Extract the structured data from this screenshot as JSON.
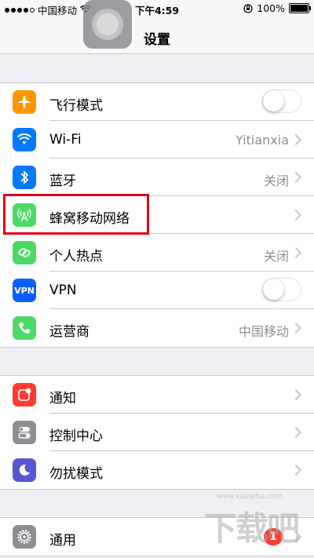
{
  "status_bar": {
    "carrier": "中国移动",
    "time": "下午4:59",
    "battery_percent": "100%",
    "signal_bars": 4
  },
  "nav": {
    "title": "设置"
  },
  "groups": [
    {
      "rows": [
        {
          "label": "飞行模式",
          "icon": "airplane-icon",
          "icon_color": "#ff9500",
          "control": "toggle",
          "on": false
        },
        {
          "label": "Wi-Fi",
          "icon": "wifi-icon",
          "icon_color": "#007aff",
          "value": "Yitianxia",
          "control": "chevron"
        },
        {
          "label": "蓝牙",
          "icon": "bluetooth-icon",
          "icon_color": "#007aff",
          "value": "关闭",
          "control": "chevron"
        },
        {
          "label": "蜂窝移动网络",
          "icon": "cellular-icon",
          "icon_color": "#4cd964",
          "control": "chevron"
        },
        {
          "label": "个人热点",
          "icon": "hotspot-icon",
          "icon_color": "#4cd964",
          "value": "关闭",
          "control": "chevron"
        },
        {
          "label": "VPN",
          "icon": "vpn-icon",
          "icon_text": "VPN",
          "icon_color": "#0a60ff",
          "control": "toggle",
          "on": false
        },
        {
          "label": "运营商",
          "icon": "phone-icon",
          "icon_color": "#4cd964",
          "value": "中国移动",
          "control": "chevron"
        }
      ]
    },
    {
      "rows": [
        {
          "label": "通知",
          "icon": "notifications-icon",
          "icon_color": "#ff3b30",
          "control": "chevron"
        },
        {
          "label": "控制中心",
          "icon": "control-center-icon",
          "icon_color": "#8e8e93",
          "control": "chevron"
        },
        {
          "label": "勿扰模式",
          "icon": "moon-icon",
          "icon_color": "#5856d6",
          "control": "chevron"
        }
      ]
    },
    {
      "rows": [
        {
          "label": "通用",
          "icon": "gear-icon",
          "icon_color": "#8e8e93",
          "badge": "1",
          "control": "chevron"
        }
      ]
    }
  ],
  "watermark": {
    "text": "下载吧",
    "url": "www.xiazaiba.com"
  },
  "highlight_color": "#e00012"
}
